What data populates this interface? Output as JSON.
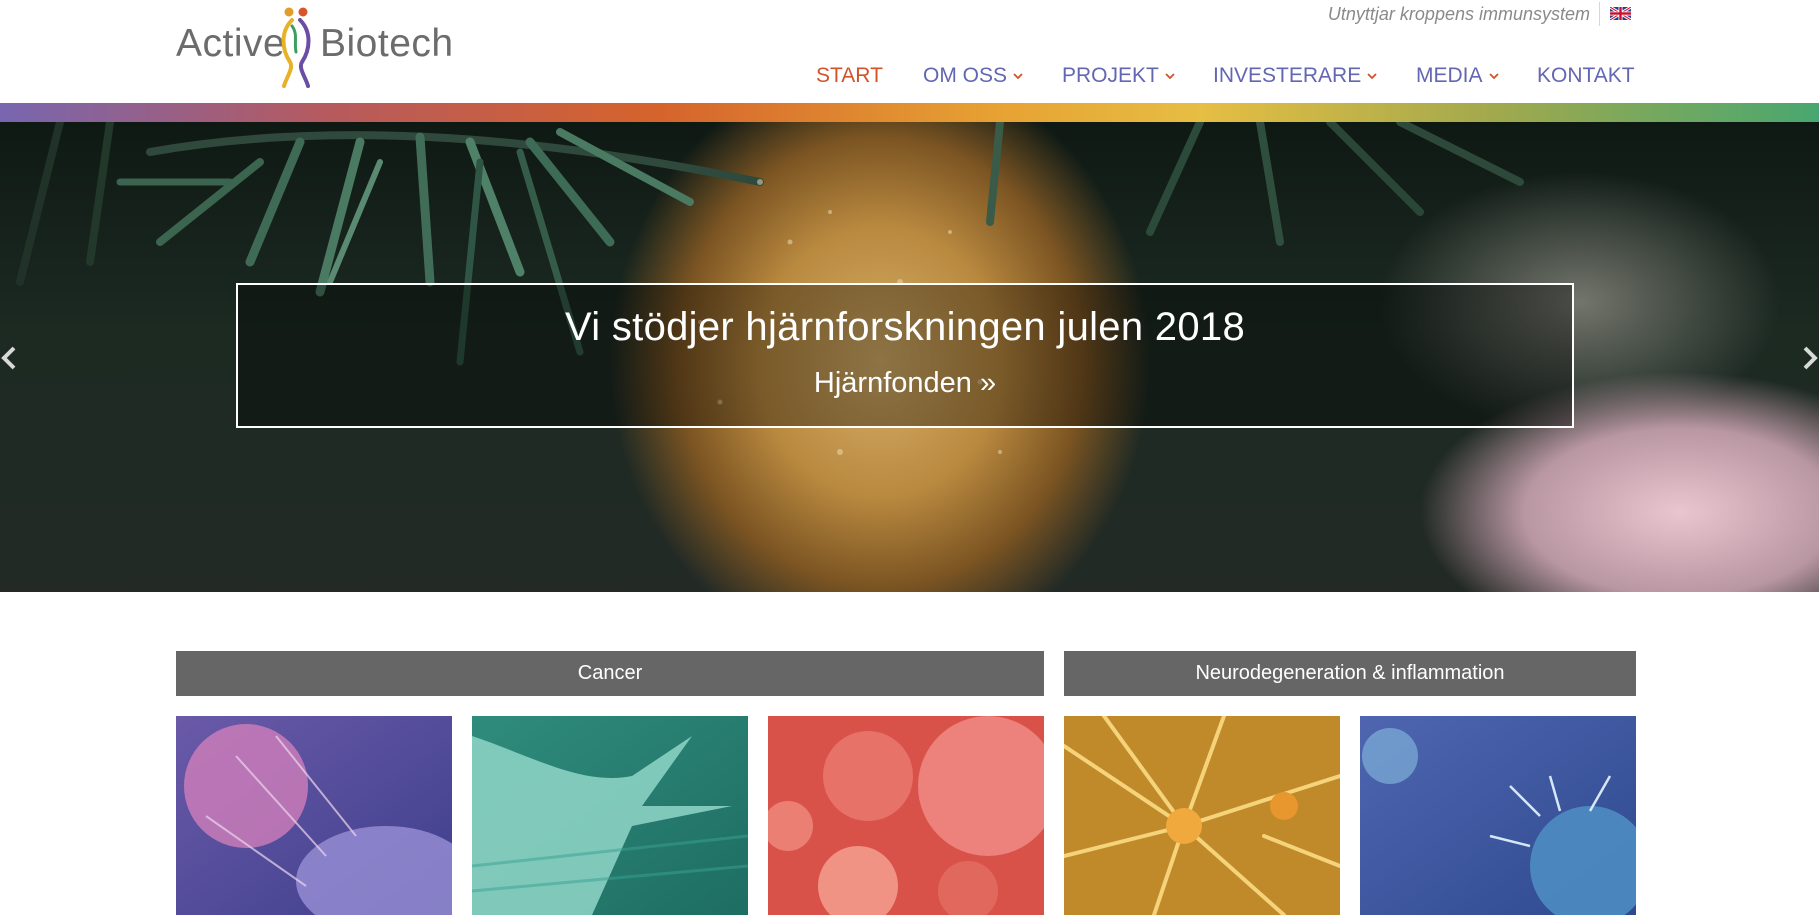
{
  "brand": {
    "left_word": "Active",
    "right_word": "Biotech"
  },
  "top": {
    "tagline": "Utnyttjar kroppens immunsystem",
    "language_icon": "uk-flag-icon"
  },
  "nav": [
    {
      "label": "START",
      "active": true,
      "dropdown": false
    },
    {
      "label": "OM OSS",
      "active": false,
      "dropdown": true
    },
    {
      "label": "PROJEKT",
      "active": false,
      "dropdown": true
    },
    {
      "label": "INVESTERARE",
      "active": false,
      "dropdown": true
    },
    {
      "label": "MEDIA",
      "active": false,
      "dropdown": true
    },
    {
      "label": "KONTAKT",
      "active": false,
      "dropdown": false
    }
  ],
  "hero": {
    "title": "Vi stödjer hjärnforskningen julen 2018",
    "link_label": "Hjärnfonden »",
    "prev_icon": "arrow-left-icon",
    "next_icon": "arrow-right-icon"
  },
  "categories": [
    {
      "label": "Cancer"
    },
    {
      "label": "Neurodegeneration & inflammation"
    }
  ],
  "colors": {
    "nav_link": "#6366b2",
    "nav_active": "#d0532a",
    "category_bar": "#666666",
    "tiles": [
      "#8a6fb5",
      "#4fa494",
      "#db5848",
      "#d6a43a",
      "#4f67a8"
    ]
  }
}
